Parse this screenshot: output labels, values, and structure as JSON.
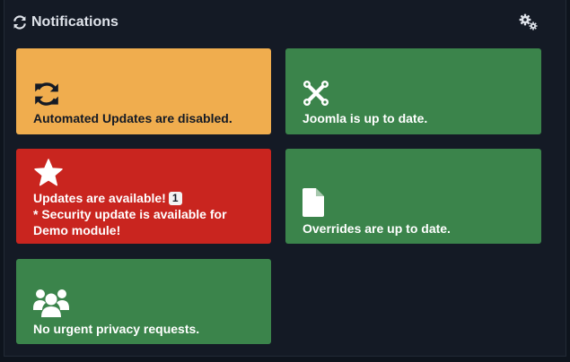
{
  "header": {
    "title": "Notifications",
    "refresh_icon": "refresh-icon",
    "settings_icon": "cogs-icon"
  },
  "tiles": [
    {
      "icon": "sync-icon",
      "color": "#f0ad4e",
      "text": "Automated Updates are disabled."
    },
    {
      "icon": "joomla-icon",
      "color": "#3b844b",
      "text": "Joomla is up to date."
    },
    {
      "icon": "star-icon",
      "color": "#c9251f",
      "text": "Updates are available!",
      "badge": "1",
      "text2": "* Security update is available for Demo module!"
    },
    {
      "icon": "file-icon",
      "color": "#3b844b",
      "text": "Overrides are up to date."
    },
    {
      "icon": "users-icon",
      "color": "#3b844b",
      "text": "No urgent privacy requests."
    }
  ]
}
